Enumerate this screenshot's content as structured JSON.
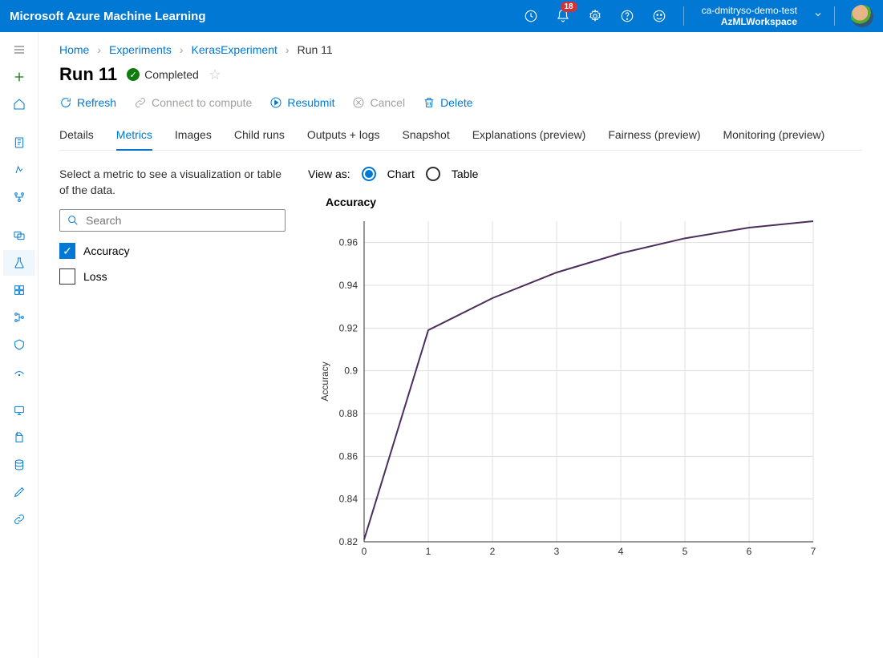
{
  "topbar": {
    "title": "Microsoft Azure Machine Learning",
    "badge": "18",
    "account": "ca-dmitryso-demo-test",
    "workspace": "AzMLWorkspace"
  },
  "breadcrumb": {
    "items": [
      "Home",
      "Experiments",
      "KerasExperiment"
    ],
    "current": "Run 11"
  },
  "page": {
    "title": "Run 11",
    "status": "Completed"
  },
  "actions": {
    "refresh": "Refresh",
    "connect": "Connect to compute",
    "resubmit": "Resubmit",
    "cancel": "Cancel",
    "delete": "Delete"
  },
  "tabs": [
    "Details",
    "Metrics",
    "Images",
    "Child runs",
    "Outputs + logs",
    "Snapshot",
    "Explanations (preview)",
    "Fairness (preview)",
    "Monitoring (preview)"
  ],
  "metrics_panel": {
    "help": "Select a metric to see a visualization or table of the data.",
    "search_placeholder": "Search",
    "items": [
      {
        "label": "Accuracy",
        "checked": true
      },
      {
        "label": "Loss",
        "checked": false
      }
    ]
  },
  "view_as": {
    "label": "View as:",
    "chart": "Chart",
    "table": "Table"
  },
  "chart_data": {
    "type": "line",
    "title": "Accuracy",
    "xlabel": "",
    "ylabel": "Accuracy",
    "x": [
      0,
      1,
      2,
      3,
      4,
      5,
      6,
      7
    ],
    "y": [
      0.821,
      0.919,
      0.934,
      0.946,
      0.955,
      0.962,
      0.967,
      0.97
    ],
    "xlim": [
      0,
      7
    ],
    "ylim": [
      0.82,
      0.97
    ],
    "yticks": [
      0.82,
      0.84,
      0.86,
      0.88,
      0.9,
      0.92,
      0.94,
      0.96
    ],
    "xticks": [
      0,
      1,
      2,
      3,
      4,
      5,
      6,
      7
    ]
  }
}
